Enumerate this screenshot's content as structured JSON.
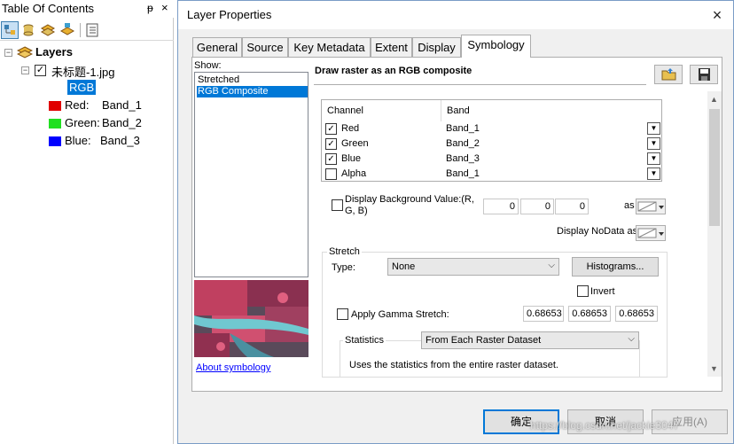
{
  "toc": {
    "title": "Table Of Contents",
    "pin": "ᵽ",
    "close": "×",
    "layers_label": "Layers",
    "layer_name": "未标题-1.jpg",
    "rgb_label": "RGB",
    "channels": [
      {
        "label": "Red:",
        "band": "Band_1",
        "color": "#e00000"
      },
      {
        "label": "Green:",
        "band": "Band_2",
        "color": "#20e020"
      },
      {
        "label": "Blue:",
        "band": "Band_3",
        "color": "#0000ff"
      }
    ]
  },
  "dialog": {
    "title": "Layer Properties",
    "close": "×",
    "tabs": [
      "General",
      "Source",
      "Key Metadata",
      "Extent",
      "Display",
      "Symbology"
    ],
    "active_tab": "Symbology",
    "show_label": "Show:",
    "show_items": [
      "Stretched",
      "RGB Composite"
    ],
    "selected_show": "RGB Composite",
    "about_link": "About symbology",
    "header": "Draw raster as an RGB composite",
    "channel_table": {
      "col_channel": "Channel",
      "col_band": "Band",
      "rows": [
        {
          "channel": "Red",
          "band": "Band_1",
          "checked": "✓"
        },
        {
          "channel": "Green",
          "band": "Band_2",
          "checked": "✓"
        },
        {
          "channel": "Blue",
          "band": "Band_3",
          "checked": "✓"
        },
        {
          "channel": "Alpha",
          "band": "Band_1",
          "checked": ""
        }
      ]
    },
    "background": {
      "label_line1": "Display Background Value:(R,",
      "label_line2": "G, B)",
      "values": [
        "0",
        "0",
        "0"
      ],
      "as_label": "as"
    },
    "nodata_label": "Display NoData as",
    "stretch": {
      "group_label": "Stretch",
      "type_label": "Type:",
      "type_value": "None",
      "histograms_button": "Histograms...",
      "invert_label": "Invert",
      "gamma_label": "Apply Gamma Stretch:",
      "gamma_values": [
        "0.68653",
        "0.68653",
        "0.68653"
      ]
    },
    "statistics": {
      "label": "Statistics",
      "value": "From Each Raster Dataset",
      "description": "Uses the statistics from the entire raster dataset."
    },
    "buttons": {
      "ok": "确定",
      "cancel": "取消",
      "apply": "应用(A)"
    }
  },
  "watermark": "https://blog.csdn.net/jackie3047"
}
